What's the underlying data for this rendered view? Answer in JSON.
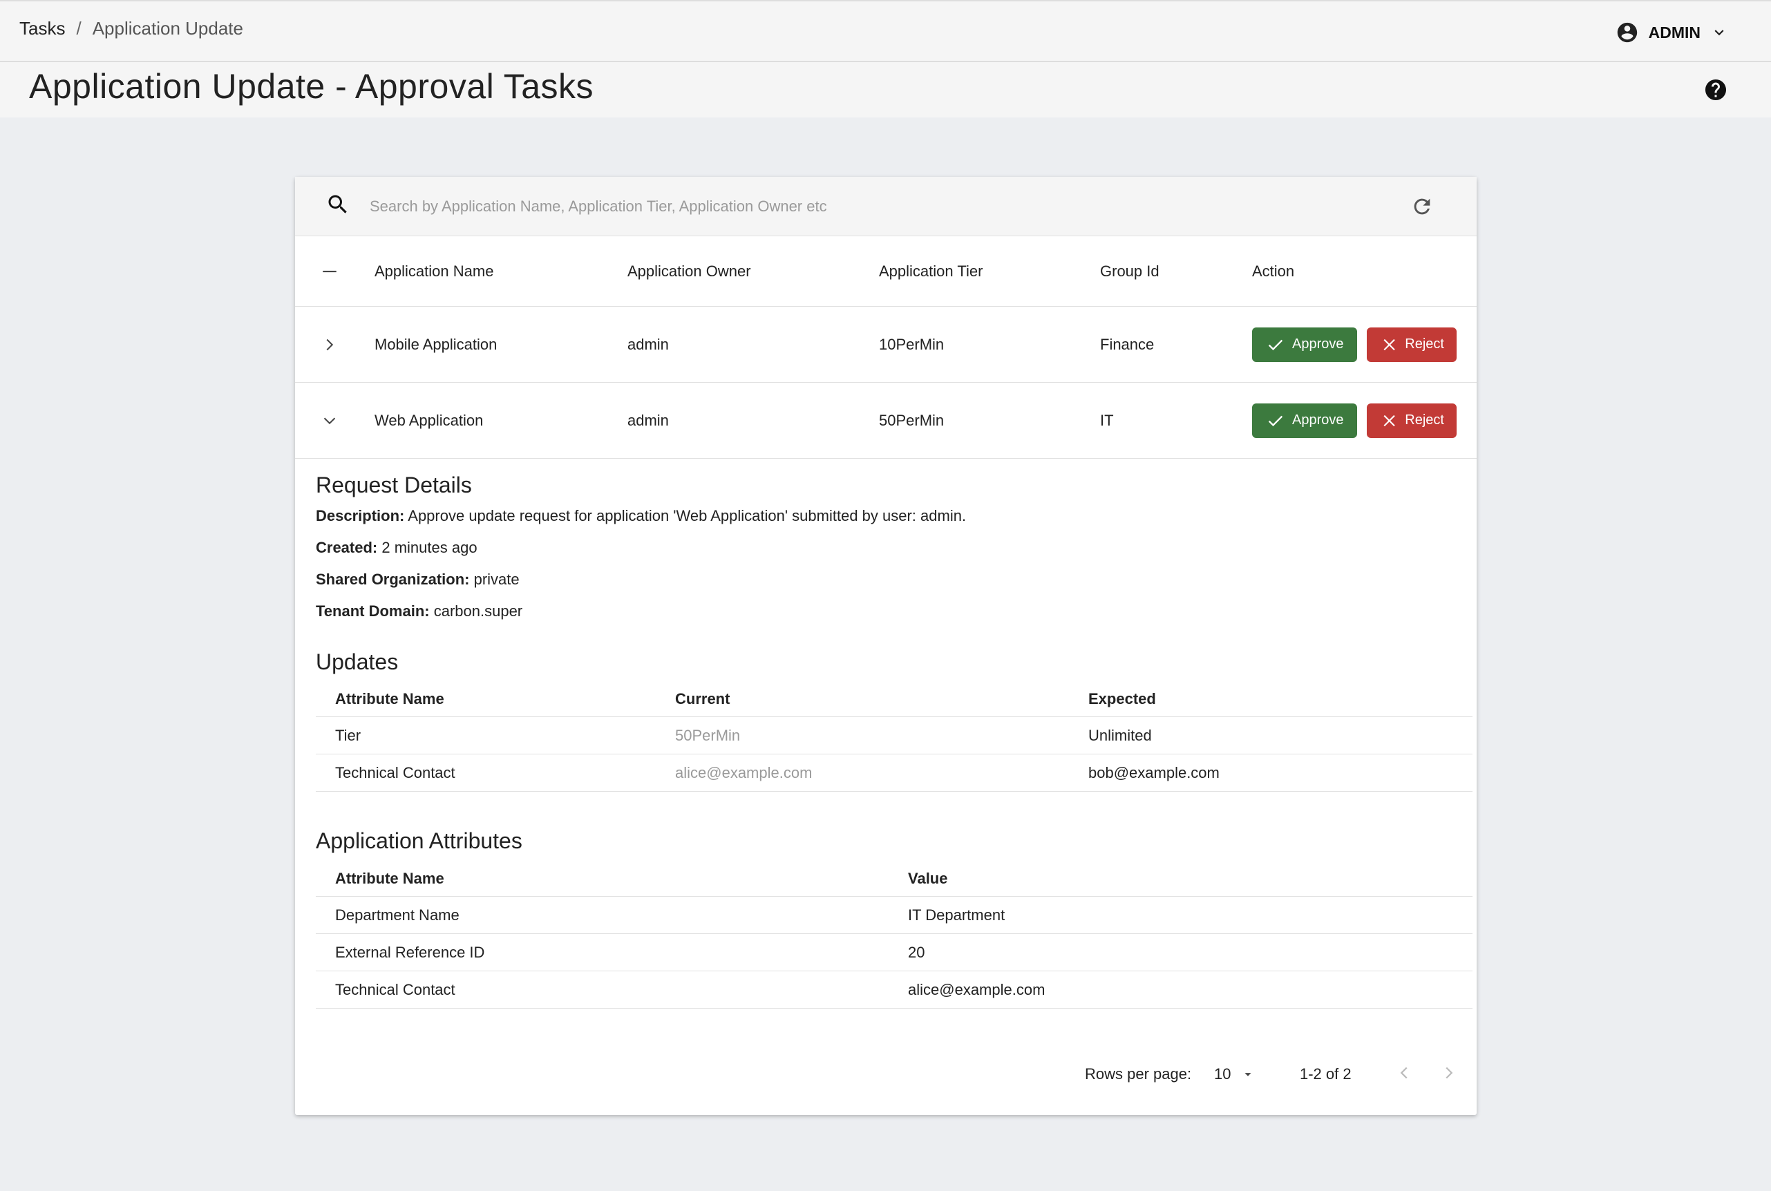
{
  "breadcrumb": {
    "root": "Tasks",
    "separator": "/",
    "current": "Application Update"
  },
  "user": {
    "label": "ADMIN"
  },
  "page": {
    "title": "Application Update - Approval Tasks"
  },
  "search": {
    "placeholder": "Search by Application Name, Application Tier, Application Owner etc"
  },
  "table": {
    "headers": [
      "Application Name",
      "Application Owner",
      "Application Tier",
      "Group Id",
      "Action"
    ],
    "rows": [
      {
        "name": "Mobile Application",
        "owner": "admin",
        "tier": "10PerMin",
        "group": "Finance",
        "approve": "Approve",
        "reject": "Reject"
      },
      {
        "name": "Web Application",
        "owner": "admin",
        "tier": "50PerMin",
        "group": "IT",
        "approve": "Approve",
        "reject": "Reject"
      }
    ]
  },
  "details": {
    "title": "Request Details",
    "description_label": "Description:",
    "description": "Approve update request for application 'Web Application' submitted by user: admin.",
    "created_label": "Created:",
    "created": "2 minutes ago",
    "shared_label": "Shared Organization:",
    "shared": "private",
    "tenant_label": "Tenant Domain:",
    "tenant": "carbon.super"
  },
  "updates": {
    "title": "Updates",
    "headers": [
      "Attribute Name",
      "Current",
      "Expected"
    ],
    "rows": [
      {
        "name": "Tier",
        "current": "50PerMin",
        "expected": "Unlimited"
      },
      {
        "name": "Technical Contact",
        "current": "alice@example.com",
        "expected": "bob@example.com"
      }
    ]
  },
  "attributes": {
    "title": "Application Attributes",
    "headers": [
      "Attribute Name",
      "Value"
    ],
    "rows": [
      {
        "name": "Department Name",
        "value": "IT Department"
      },
      {
        "name": "External Reference ID",
        "value": "20"
      },
      {
        "name": "Technical Contact",
        "value": "alice@example.com"
      }
    ]
  },
  "pagination": {
    "rows_label": "Rows per page:",
    "rows_value": "10",
    "range": "1-2 of 2"
  },
  "colors": {
    "approve": "#3c7a3e",
    "reject": "#c23a36",
    "background": "#eceef1"
  },
  "icons": [
    "account-circle-icon",
    "chevron-down-icon",
    "help-icon",
    "search-icon",
    "refresh-icon",
    "collapse-all-icon",
    "chevron-right-icon",
    "check-icon",
    "close-icon",
    "chevron-left-icon",
    "dropdown-arrow-icon"
  ]
}
